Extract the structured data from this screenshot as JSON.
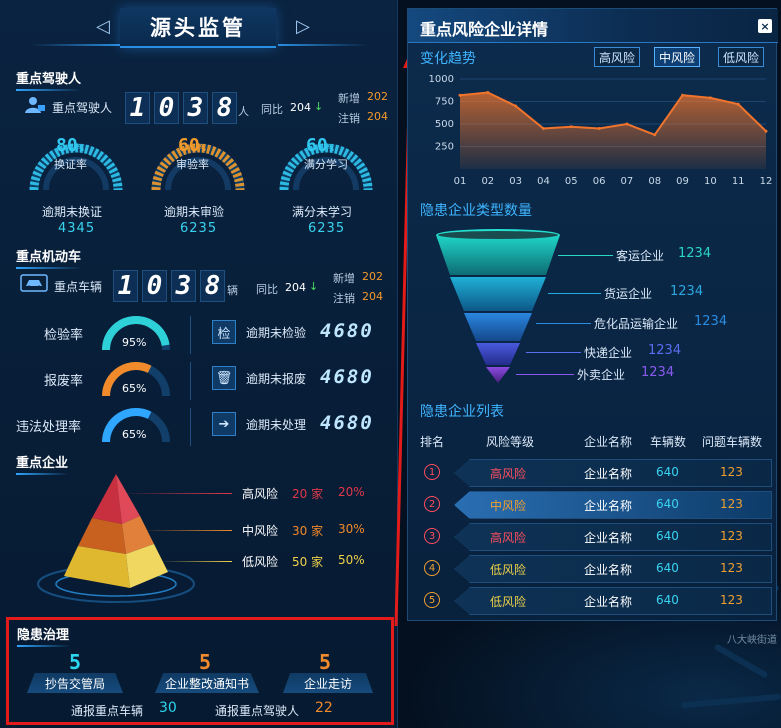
{
  "left": {
    "title": "源头监管",
    "nav_prev": "◁",
    "nav_next": "▷",
    "drivers": {
      "section": "重点驾驶人",
      "label": "重点驾驶人",
      "digits": [
        "1",
        "0",
        "3",
        "8"
      ],
      "unit": "人",
      "yoy_label": "同比",
      "yoy_value": "204",
      "new_label": "新增",
      "new_value": "202",
      "cancel_label": "注销",
      "cancel_value": "204",
      "gauges": [
        {
          "value": "80",
          "pct": "%",
          "name": "换证率",
          "caption": "逾期未换证",
          "count": "4345",
          "color": "#31c8f0"
        },
        {
          "value": "60",
          "pct": "%",
          "name": "审验率",
          "caption": "逾期未审验",
          "count": "6235",
          "color": "#f39a2b"
        },
        {
          "value": "60",
          "pct": "%",
          "name": "满分学习",
          "caption": "满分未学习",
          "count": "6235",
          "color": "#31c8f0"
        }
      ]
    },
    "vehicles": {
      "section": "重点机动车",
      "label": "重点车辆",
      "digits": [
        "1",
        "0",
        "3",
        "8"
      ],
      "unit": "辆",
      "yoy_label": "同比",
      "yoy_value": "204",
      "new_label": "新增",
      "new_value": "202",
      "cancel_label": "注销",
      "cancel_value": "204",
      "rates": [
        {
          "name": "检验率",
          "value": "95%",
          "level": 0.95,
          "color": "#2fd1d8",
          "icon": "shield-check-icon",
          "glyph": "检",
          "item": "逾期未检验",
          "count": "4680"
        },
        {
          "name": "报废率",
          "value": "65%",
          "level": 0.65,
          "color": "#f08a2a",
          "icon": "trash-icon",
          "glyph": "🗑",
          "item": "逾期未报废",
          "count": "4680"
        },
        {
          "name": "违法处理率",
          "value": "65%",
          "level": 0.65,
          "color": "#2fa6ff",
          "icon": "arrow-right-icon",
          "glyph": "➔",
          "item": "逾期未处理",
          "count": "4680"
        }
      ]
    },
    "enterprise": {
      "section": "重点企业",
      "levels": [
        {
          "name": "高风险",
          "count": "20 家",
          "pct": "20%",
          "color": "#e0384a"
        },
        {
          "name": "中风险",
          "count": "30 家",
          "pct": "30%",
          "color": "#f08a2a"
        },
        {
          "name": "低风险",
          "count": "50 家",
          "pct": "50%",
          "color": "#f0d24a"
        }
      ]
    },
    "hazard": {
      "section": "隐患治理",
      "items": [
        {
          "num": "5",
          "label": "抄告交管局",
          "color": "#2ad6f0"
        },
        {
          "num": "5",
          "label": "企业整改通知书",
          "color": "#f08a2a"
        },
        {
          "num": "5",
          "label": "企业走访",
          "color": "#f08a2a"
        }
      ],
      "veh_label": "通报重点车辆",
      "veh_value": "30",
      "drv_label": "通报重点驾驶人",
      "drv_value": "22"
    }
  },
  "right": {
    "title": "重点风险企业详情",
    "close": "×",
    "trend": {
      "section": "变化趋势",
      "buttons": [
        "高风险",
        "中风险",
        "低风险"
      ],
      "active": "中风险"
    },
    "chart_data": {
      "type": "area",
      "x": [
        "01",
        "02",
        "03",
        "04",
        "05",
        "06",
        "07",
        "08",
        "09",
        "10",
        "11",
        "12"
      ],
      "values": [
        820,
        850,
        700,
        450,
        470,
        450,
        500,
        380,
        820,
        790,
        720,
        420
      ],
      "ylim": [
        0,
        1000
      ],
      "yticks": [
        "1000",
        "750",
        "500",
        "250"
      ],
      "color": "#f0742b"
    },
    "types": {
      "section": "隐患企业类型数量",
      "items": [
        {
          "name": "客运企业",
          "value": "1234",
          "color": "#2ad6c8"
        },
        {
          "name": "货运企业",
          "value": "1234",
          "color": "#2aa9e0"
        },
        {
          "name": "危化品运输企业",
          "value": "1234",
          "color": "#2a8ce0"
        },
        {
          "name": "快递企业",
          "value": "1234",
          "color": "#5a6ef0"
        },
        {
          "name": "外卖企业",
          "value": "1234",
          "color": "#8a5af0"
        }
      ]
    },
    "list": {
      "section": "隐患企业列表",
      "headers": [
        "排名",
        "风险等级",
        "企业名称",
        "车辆数",
        "问题车辆数"
      ],
      "rows": [
        {
          "rank": "1",
          "level": "高风险",
          "name": "企业名称",
          "vehicles": "640",
          "problem": "123",
          "level_color": "#ff4d5e",
          "rank_color": "#ff4d5e"
        },
        {
          "rank": "2",
          "level": "中风险",
          "name": "企业名称",
          "vehicles": "640",
          "problem": "123",
          "level_color": "#f0a030",
          "rank_color": "#ff4d5e"
        },
        {
          "rank": "3",
          "level": "高风险",
          "name": "企业名称",
          "vehicles": "640",
          "problem": "123",
          "level_color": "#ff4d5e",
          "rank_color": "#ff4d5e"
        },
        {
          "rank": "4",
          "level": "低风险",
          "name": "企业名称",
          "vehicles": "640",
          "problem": "123",
          "level_color": "#f0d24a",
          "rank_color": "#f0a030"
        },
        {
          "rank": "5",
          "level": "低风险",
          "name": "企业名称",
          "vehicles": "640",
          "problem": "123",
          "level_color": "#f0d24a",
          "rank_color": "#f0a030"
        }
      ]
    }
  },
  "map": {
    "label": "八大峡街道"
  }
}
